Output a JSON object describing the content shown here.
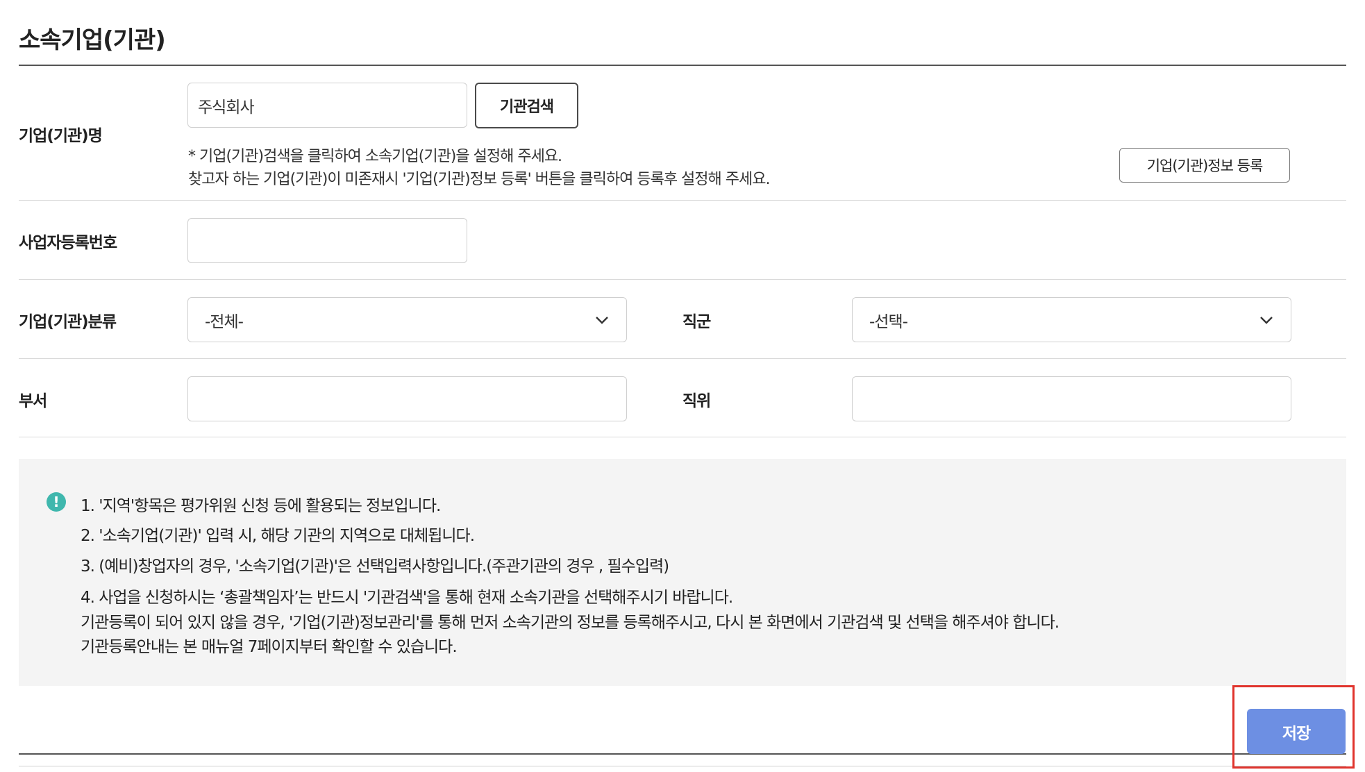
{
  "page": {
    "title": "소속기업(기관)"
  },
  "form": {
    "company_name": {
      "label": "기업(기관)명",
      "value": "주식회사",
      "search_button": "기관검색",
      "note_line1": "* 기업(기관)검색을 클릭하여 소속기업(기관)을 설정해 주세요.",
      "note_line2": "찾고자 하는 기업(기관)이 미존재시 '기업(기관)정보 등록' 버튼을 클릭하여 등록후 설정해 주세요.",
      "register_button": "기업(기관)정보 등록"
    },
    "business_number": {
      "label": "사업자등록번호",
      "value": ""
    },
    "classification": {
      "label": "기업(기관)분류",
      "selected": "-전체-"
    },
    "job_group": {
      "label": "직군",
      "selected": "-선택-"
    },
    "department": {
      "label": "부서",
      "value": ""
    },
    "position": {
      "label": "직위",
      "value": ""
    }
  },
  "info": {
    "icon": "exclamation-icon",
    "lines": [
      "1. '지역'항목은 평가위원 신청 등에 활용되는 정보입니다.",
      "2. '소속기업(기관)' 입력 시, 해당 기관의 지역으로 대체됩니다.",
      "3. (예비)창업자의 경우, '소속기업(기관)'은 선택입력사항입니다.(주관기관의 경우 , 필수입력)",
      "4. 사업을 신청하시는 ‘총괄책임자’는 반드시 '기관검색'을 통해 현재 소속기관을 선택해주시기 바랍니다.",
      "기관등록이 되어 있지 않을 경우, '기업(기관)정보관리'를 통해 먼저 소속기관의 정보를 등록해주시고, 다시 본 화면에서 기관검색 및 선택을 해주셔야 합니다.",
      "기관등록안내는 본 매뉴얼 7페이지부터 확인할 수 있습니다."
    ]
  },
  "actions": {
    "save_label": "저장"
  },
  "colors": {
    "accent": "#6d8fe3",
    "info_icon": "#3fb7ad",
    "highlight": "#e0332c"
  }
}
